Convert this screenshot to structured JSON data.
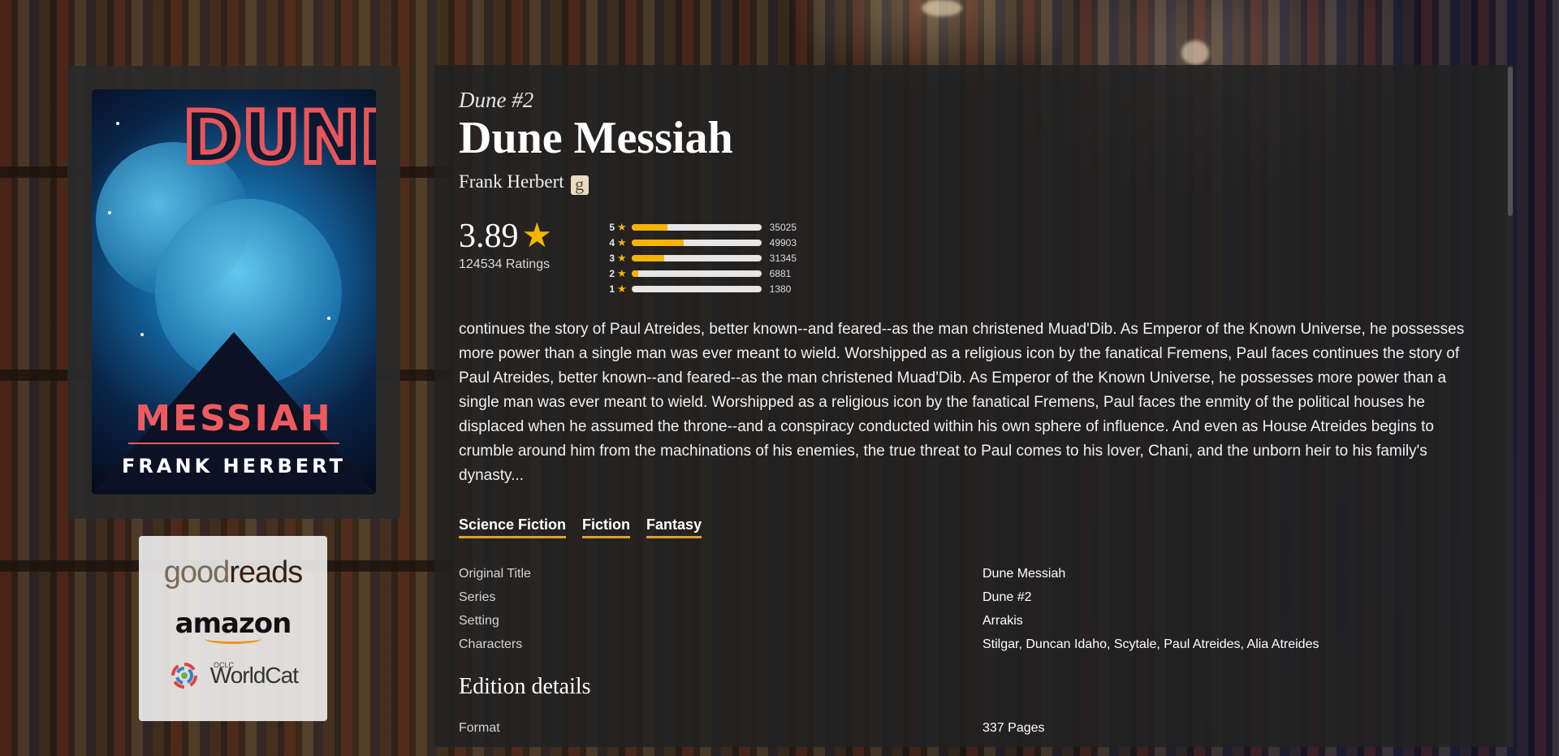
{
  "book": {
    "series": "Dune #2",
    "title": "Dune Messiah",
    "author": "Frank Herbert",
    "author_badge": "g",
    "rating": "3.89",
    "ratings_count": "124534 Ratings",
    "star_glyph": "★",
    "distribution": [
      {
        "level": "5",
        "count": "35025",
        "fraction": 0.28
      },
      {
        "level": "4",
        "count": "49903",
        "fraction": 0.4
      },
      {
        "level": "3",
        "count": "31345",
        "fraction": 0.25
      },
      {
        "level": "2",
        "count": "6881",
        "fraction": 0.055
      },
      {
        "level": "1",
        "count": "1380",
        "fraction": 0.011
      }
    ],
    "description": "continues the story of Paul Atreides, better known--and feared--as the man christened Muad'Dib. As Emperor of the Known Universe, he possesses more power than a single man was ever meant to wield. Worshipped as a religious icon by the fanatical Fremens, Paul faces continues the story of Paul Atreides, better known--and feared--as the man christened Muad'Dib. As Emperor of the Known Universe, he possesses more power than a single man was ever meant to wield. Worshipped as a religious icon by the fanatical Fremens, Paul faces the enmity of the political houses he displaced when he assumed the throne--and a conspiracy conducted within his own sphere of influence. And even as House Atreides begins to crumble around him from the machinations of his enemies, the true threat to Paul comes to his lover, Chani, and the unborn heir to his family's dynasty...",
    "genres": [
      "Science Fiction",
      "Fiction",
      "Fantasy"
    ],
    "details": [
      {
        "key": "Original Title",
        "value": "Dune Messiah"
      },
      {
        "key": "Series",
        "value": "Dune #2"
      },
      {
        "key": "Setting",
        "value": "Arrakis"
      },
      {
        "key": "Characters",
        "value": "Stilgar, Duncan Idaho, Scytale, Paul Atreides, Alia Atreides"
      }
    ],
    "edition_heading": "Edition details",
    "edition": [
      {
        "key": "Format",
        "value": "337 Pages"
      }
    ]
  },
  "cover": {
    "title_letters": "DUNE",
    "subtitle": "MESSIAH",
    "author": "FRANK HERBERT"
  },
  "stores": {
    "goodreads_a": "good",
    "goodreads_b": "reads",
    "amazon": "amazon",
    "worldcat_small": "OCLC",
    "worldcat": "WorldCat"
  },
  "colors": {
    "accent": "#f5b400",
    "genre_underline": "#e0a02c",
    "panel": "#222222"
  }
}
